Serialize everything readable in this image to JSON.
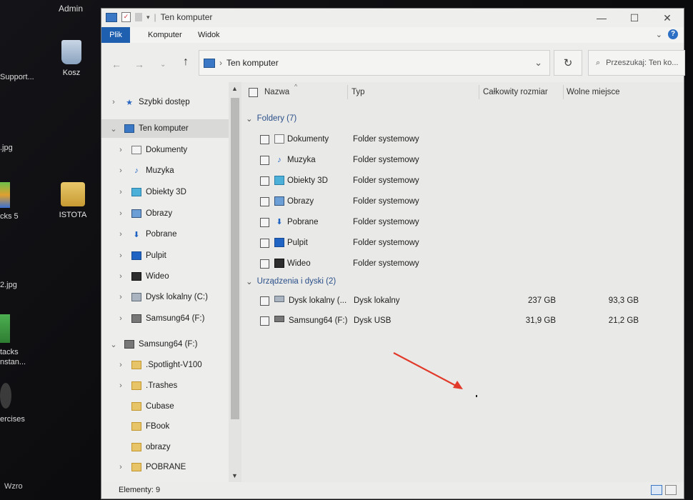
{
  "desktop": {
    "top_label": "Admin",
    "icons": [
      {
        "label": "Kosz"
      },
      {
        "label": "ISTOTA"
      }
    ],
    "edge_labels": [
      "Support...",
      ".jpg",
      "cks 5",
      "2.jpg",
      "tacks",
      "nstan...",
      "ercises",
      "Wzro"
    ]
  },
  "window": {
    "title": "Ten komputer",
    "controls": {
      "minimize": "—",
      "maximize": "☐",
      "close": "✕"
    }
  },
  "ribbon": {
    "tabs": [
      "Plik",
      "Komputer",
      "Widok"
    ],
    "help": "?"
  },
  "address": {
    "path": "Ten komputer",
    "search_placeholder": "Przeszukaj: Ten ko..."
  },
  "nav": {
    "items": [
      {
        "label": "Szybki dostęp",
        "icon": "star-icon",
        "chev": "›"
      },
      {
        "label": "Ten komputer",
        "icon": "computer-icon",
        "chev": "⌄"
      },
      {
        "label": "Dokumenty",
        "icon": "document-icon",
        "chev": "›"
      },
      {
        "label": "Muzyka",
        "icon": "music-icon",
        "chev": "›"
      },
      {
        "label": "Obiekty 3D",
        "icon": "cube-icon",
        "chev": "›"
      },
      {
        "label": "Obrazy",
        "icon": "picture-icon",
        "chev": "›"
      },
      {
        "label": "Pobrane",
        "icon": "download-icon",
        "chev": "›"
      },
      {
        "label": "Pulpit",
        "icon": "desktop-icon",
        "chev": "›"
      },
      {
        "label": "Wideo",
        "icon": "video-icon",
        "chev": "›"
      },
      {
        "label": "Dysk lokalny (C:)",
        "icon": "disk-icon",
        "chev": "›"
      },
      {
        "label": "Samsung64 (F:)",
        "icon": "usb-drive-icon",
        "chev": "›"
      },
      {
        "label": "Samsung64 (F:)",
        "icon": "usb-drive-icon",
        "chev": "⌄"
      },
      {
        "label": ".Spotlight-V100",
        "icon": "folder-icon",
        "chev": "›"
      },
      {
        "label": ".Trashes",
        "icon": "folder-icon",
        "chev": "›"
      },
      {
        "label": "Cubase",
        "icon": "folder-icon",
        "chev": ""
      },
      {
        "label": "FBook",
        "icon": "folder-icon",
        "chev": ""
      },
      {
        "label": "obrazy",
        "icon": "folder-icon",
        "chev": ""
      },
      {
        "label": "POBRANE",
        "icon": "folder-icon",
        "chev": "›"
      }
    ]
  },
  "columns": {
    "name": "Nazwa",
    "type": "Typ",
    "total": "Całkowity rozmiar",
    "free": "Wolne miejsce"
  },
  "groups": {
    "folders": "Foldery (7)",
    "devices": "Urządzenia i dyski (2)"
  },
  "folders": [
    {
      "name": "Dokumenty",
      "type": "Folder systemowy",
      "icon": "document-icon"
    },
    {
      "name": "Muzyka",
      "type": "Folder systemowy",
      "icon": "music-icon"
    },
    {
      "name": "Obiekty 3D",
      "type": "Folder systemowy",
      "icon": "cube-icon"
    },
    {
      "name": "Obrazy",
      "type": "Folder systemowy",
      "icon": "picture-icon"
    },
    {
      "name": "Pobrane",
      "type": "Folder systemowy",
      "icon": "download-icon"
    },
    {
      "name": "Pulpit",
      "type": "Folder systemowy",
      "icon": "desktop-icon"
    },
    {
      "name": "Wideo",
      "type": "Folder systemowy",
      "icon": "video-icon"
    }
  ],
  "drives": [
    {
      "name": "Dysk lokalny (...",
      "type": "Dysk lokalny",
      "total": "237 GB",
      "free": "93,3 GB",
      "icon": "disk-icon"
    },
    {
      "name": "Samsung64 (F:)",
      "type": "Dysk USB",
      "total": "31,9 GB",
      "free": "21,2 GB",
      "icon": "usb-drive-icon"
    }
  ],
  "status": {
    "count": "Elementy: 9"
  },
  "colors": {
    "accent": "#1f5fb0",
    "annotation_arrow": "#e23a2a"
  }
}
